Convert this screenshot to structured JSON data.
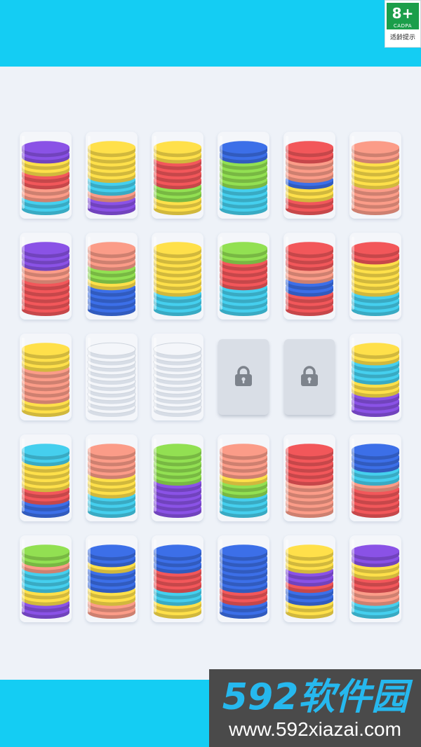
{
  "rating": {
    "age": "8+",
    "org": "CADPA",
    "tip": "适龄提示"
  },
  "colors": {
    "purple": "#8a52e6",
    "yellow": "#ffe04a",
    "red": "#f2575a",
    "salmon": "#fb9c88",
    "cyan": "#45cfee",
    "green": "#92e052",
    "blue": "#3c6fe8",
    "white": "#f4f6fa"
  },
  "board": {
    "rows": [
      {
        "tubes": [
          {
            "layers": [
              "cyan",
              "cyan",
              "salmon",
              "salmon",
              "red",
              "red",
              "yellow",
              "yellow",
              "purple",
              "purple"
            ]
          },
          {
            "layers": [
              "purple",
              "purple",
              "salmon",
              "cyan",
              "cyan",
              "yellow",
              "yellow",
              "yellow",
              "yellow",
              "yellow"
            ]
          },
          {
            "layers": [
              "yellow",
              "yellow",
              "green",
              "green",
              "red",
              "red",
              "red",
              "red",
              "yellow",
              "yellow"
            ]
          },
          {
            "layers": [
              "cyan",
              "cyan",
              "cyan",
              "cyan",
              "green",
              "green",
              "green",
              "green",
              "blue",
              "blue"
            ]
          },
          {
            "layers": [
              "red",
              "red",
              "yellow",
              "yellow",
              "blue",
              "salmon",
              "salmon",
              "salmon",
              "red",
              "red"
            ]
          },
          {
            "layers": [
              "salmon",
              "salmon",
              "salmon",
              "salmon",
              "yellow",
              "yellow",
              "yellow",
              "yellow",
              "salmon",
              "salmon"
            ]
          }
        ]
      },
      {
        "tubes": [
          {
            "layers": [
              "red",
              "red",
              "red",
              "red",
              "red",
              "salmon",
              "salmon",
              "purple",
              "purple",
              "purple"
            ]
          },
          {
            "layers": [
              "blue",
              "blue",
              "blue",
              "blue",
              "yellow",
              "green",
              "green",
              "salmon",
              "salmon",
              "salmon"
            ]
          },
          {
            "layers": [
              "cyan",
              "cyan",
              "cyan",
              "yellow",
              "yellow",
              "yellow",
              "yellow",
              "yellow",
              "yellow",
              "yellow"
            ]
          },
          {
            "layers": [
              "cyan",
              "cyan",
              "cyan",
              "cyan",
              "red",
              "red",
              "red",
              "red",
              "green",
              "green"
            ]
          },
          {
            "layers": [
              "red",
              "red",
              "red",
              "blue",
              "blue",
              "salmon",
              "salmon",
              "red",
              "red",
              "red"
            ]
          },
          {
            "layers": [
              "cyan",
              "cyan",
              "cyan",
              "yellow",
              "yellow",
              "yellow",
              "yellow",
              "yellow",
              "red",
              "red"
            ]
          }
        ]
      },
      {
        "tubes": [
          {
            "layers": [
              "yellow",
              "yellow",
              "salmon",
              "salmon",
              "salmon",
              "salmon",
              "salmon",
              "yellow",
              "yellow",
              "yellow"
            ]
          },
          {
            "empty": true,
            "layers": [
              "white",
              "white",
              "white",
              "white",
              "white",
              "white",
              "white",
              "white",
              "white",
              "white"
            ]
          },
          {
            "empty": true,
            "layers": [
              "white",
              "white",
              "white",
              "white",
              "white",
              "white",
              "white",
              "white",
              "white",
              "white"
            ]
          },
          {
            "locked": true
          },
          {
            "locked": true
          },
          {
            "layers": [
              "purple",
              "purple",
              "purple",
              "yellow",
              "yellow",
              "cyan",
              "cyan",
              "cyan",
              "yellow",
              "yellow"
            ]
          }
        ]
      },
      {
        "tubes": [
          {
            "layers": [
              "blue",
              "blue",
              "red",
              "red",
              "yellow",
              "yellow",
              "yellow",
              "yellow",
              "cyan",
              "cyan"
            ]
          },
          {
            "layers": [
              "cyan",
              "cyan",
              "cyan",
              "yellow",
              "yellow",
              "yellow",
              "salmon",
              "salmon",
              "salmon",
              "salmon"
            ]
          },
          {
            "layers": [
              "purple",
              "purple",
              "purple",
              "purple",
              "purple",
              "green",
              "green",
              "green",
              "green",
              "green"
            ]
          },
          {
            "layers": [
              "cyan",
              "cyan",
              "cyan",
              "green",
              "green",
              "yellow",
              "salmon",
              "salmon",
              "salmon",
              "salmon"
            ]
          },
          {
            "layers": [
              "salmon",
              "salmon",
              "salmon",
              "salmon",
              "salmon",
              "red",
              "red",
              "red",
              "red",
              "red"
            ]
          },
          {
            "layers": [
              "red",
              "red",
              "red",
              "red",
              "salmon",
              "cyan",
              "cyan",
              "blue",
              "blue",
              "blue"
            ]
          }
        ]
      },
      {
        "tubes": [
          {
            "layers": [
              "purple",
              "purple",
              "yellow",
              "yellow",
              "cyan",
              "cyan",
              "cyan",
              "salmon",
              "green",
              "green"
            ]
          },
          {
            "layers": [
              "salmon",
              "salmon",
              "yellow",
              "yellow",
              "blue",
              "blue",
              "blue",
              "yellow",
              "blue",
              "blue"
            ]
          },
          {
            "layers": [
              "yellow",
              "yellow",
              "cyan",
              "cyan",
              "red",
              "red",
              "red",
              "blue",
              "blue",
              "blue"
            ]
          },
          {
            "layers": [
              "blue",
              "blue",
              "red",
              "red",
              "blue",
              "blue",
              "blue",
              "blue",
              "blue",
              "blue"
            ]
          },
          {
            "layers": [
              "yellow",
              "yellow",
              "blue",
              "blue",
              "red",
              "purple",
              "purple",
              "yellow",
              "yellow",
              "yellow"
            ]
          },
          {
            "layers": [
              "cyan",
              "cyan",
              "salmon",
              "salmon",
              "red",
              "red",
              "yellow",
              "yellow",
              "purple",
              "purple"
            ]
          }
        ]
      }
    ]
  },
  "watermark": {
    "brand": "592软件园",
    "url": "www.592xiazai.com"
  }
}
